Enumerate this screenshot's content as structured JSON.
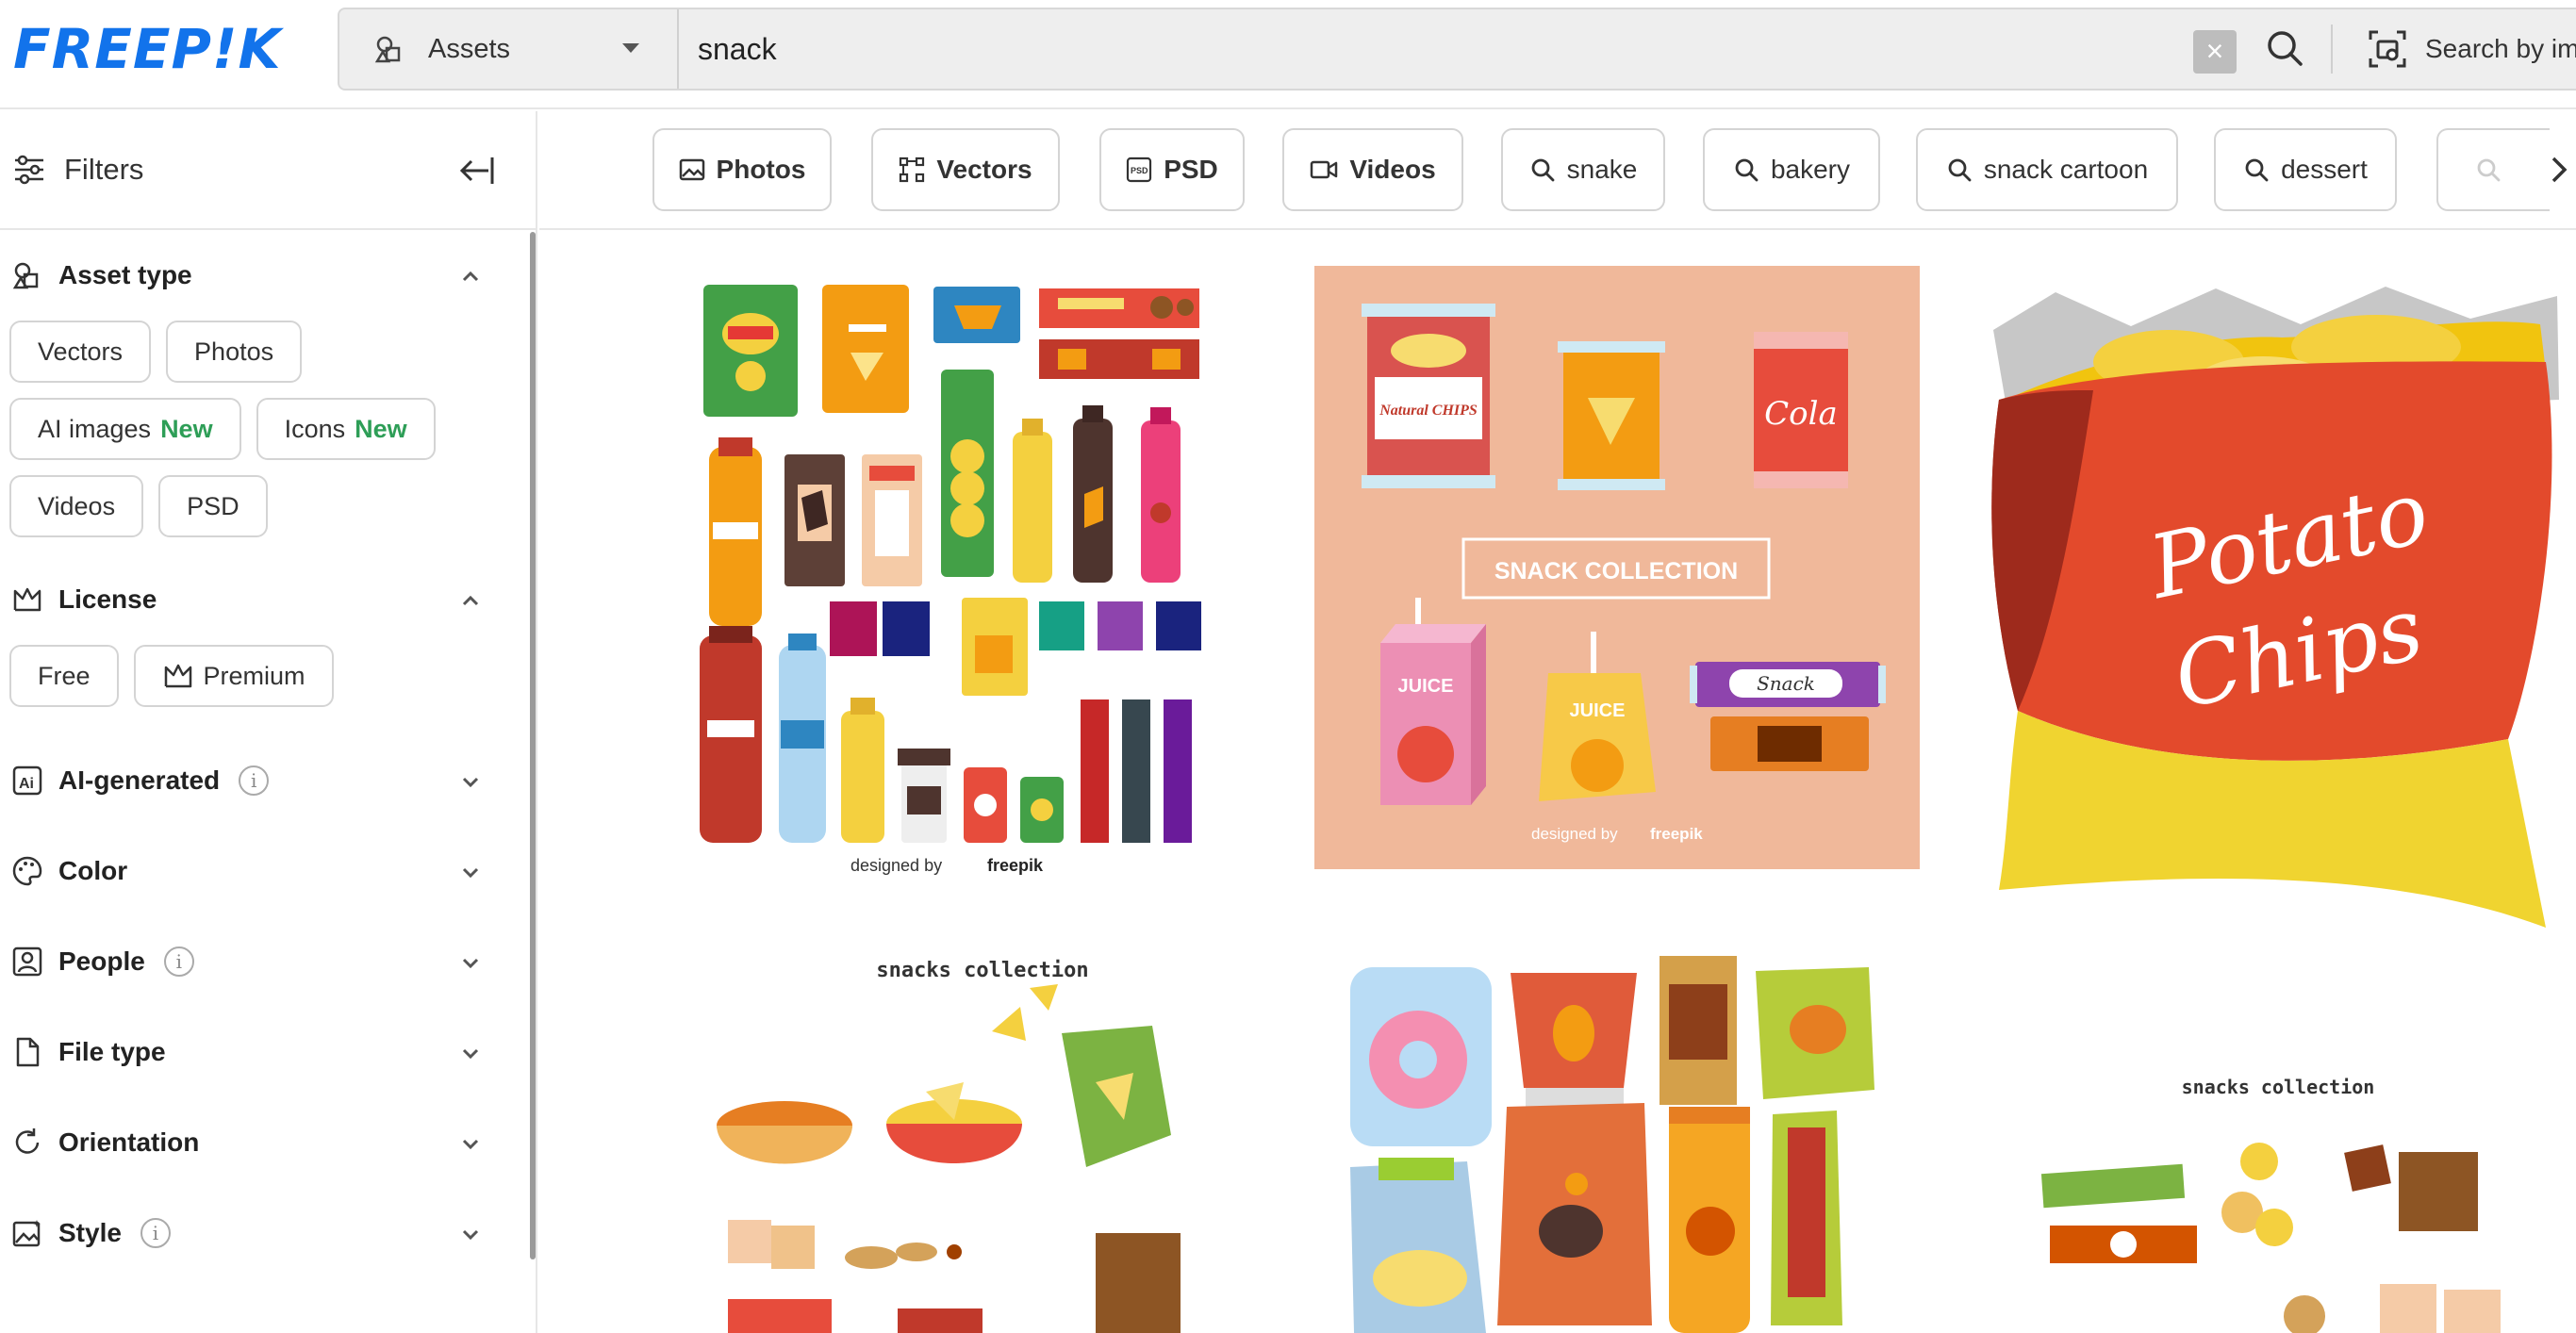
{
  "header": {
    "logo": "FREEP!K",
    "asset_select": "Assets",
    "search_value": "snack",
    "clear_label": "×",
    "image_search_label": "Search by image"
  },
  "sidebar": {
    "title": "Filters",
    "sections": {
      "asset_type": {
        "title": "Asset type",
        "chips": {
          "vectors": "Vectors",
          "photos": "Photos",
          "ai_images": "AI images",
          "icons": "Icons",
          "new_badge": "New",
          "videos": "Videos",
          "psd": "PSD"
        }
      },
      "license": {
        "title": "License",
        "chips": {
          "free": "Free",
          "premium": "Premium"
        }
      },
      "ai_generated": {
        "title": "AI-generated",
        "info": "i"
      },
      "color": {
        "title": "Color"
      },
      "people": {
        "title": "People",
        "info": "i"
      },
      "file_type": {
        "title": "File type"
      },
      "orientation": {
        "title": "Orientation"
      },
      "style": {
        "title": "Style",
        "info": "i"
      }
    }
  },
  "tags": {
    "photos": "Photos",
    "vectors": "Vectors",
    "psd": "PSD",
    "videos": "Videos",
    "snake": "snake",
    "bakery": "bakery",
    "snack_cartoon": "snack cartoon",
    "dessert": "dessert"
  },
  "results": {
    "card1": {
      "credit_prefix": "designed by",
      "credit_brand": "freepik"
    },
    "card2": {
      "banner": "SNACK COLLECTION",
      "natural_chips": "Natural CHIPS",
      "cola": "Cola",
      "juice_1": "JUICE",
      "juice_2": "JUICE",
      "snack_bar": "Snack",
      "credit_prefix": "designed by",
      "credit_brand": "freepik"
    },
    "card3": {
      "bag_text_1": "Potato",
      "bag_text_2": "Chips"
    },
    "card4": {
      "heading": "snacks collection"
    },
    "card6": {
      "heading": "snacks collection"
    }
  },
  "colors": {
    "brand_blue": "#1273eb",
    "new_green": "#2e9e57",
    "card2_bg": "#f0b89a"
  }
}
